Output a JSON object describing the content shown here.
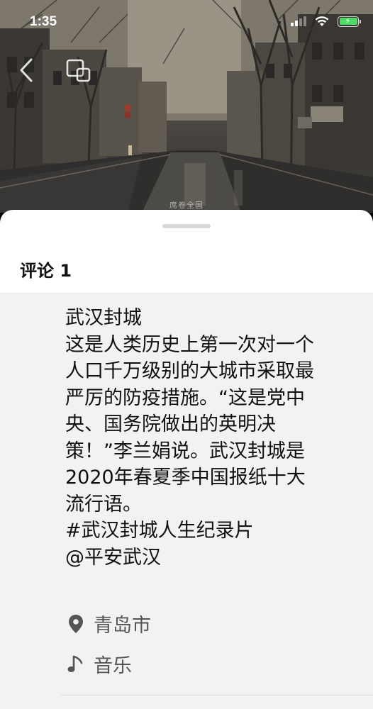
{
  "status_bar": {
    "time": "1:35"
  },
  "video": {
    "watermark": "席卷全国"
  },
  "nav": {
    "back_icon": "chevron-left-icon",
    "pip_icon": "picture-in-picture-icon"
  },
  "comments": {
    "title": "评论 1"
  },
  "post": {
    "lines": [
      "武汉封城",
      "这是人类历史上第一次对一个",
      "人口千万级别的大城市采取最",
      "严厉的防疫措施。“这是党中",
      "央、国务院做出的英明决",
      "策！”李兰娟说。武汉封城是",
      "2020年春夏季中国报纸十大",
      "流行语。",
      "#武汉封城人生纪录片",
      "@平安武汉"
    ],
    "location": "青岛市",
    "music": "音乐"
  },
  "colors": {
    "battery": "#4cd964",
    "sheet_background": "#ffffff",
    "panel_background": "#f2f2f2"
  }
}
